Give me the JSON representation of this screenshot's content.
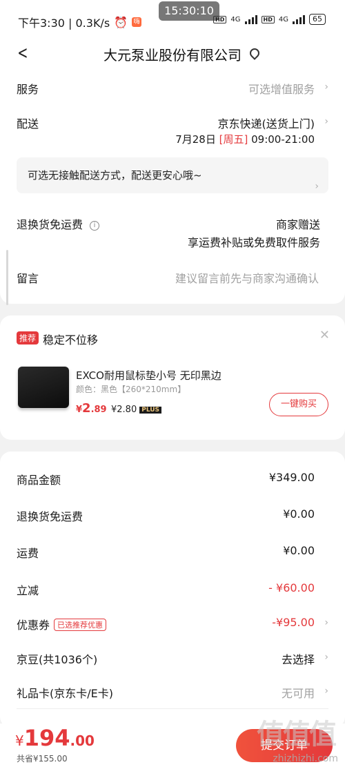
{
  "status_bar": {
    "left_text": "下午3:30 | 0.3K/s",
    "badge": "嗨",
    "time": "15:30:10",
    "net1": "HD",
    "sig1": "4G",
    "net2": "HD",
    "sig2": "4G",
    "battery": "65"
  },
  "nav": {
    "title": "大元泵业股份有限公司"
  },
  "order": {
    "service_label": "服务",
    "service_value": "可选增值服务",
    "delivery_label": "配送",
    "delivery_method": "京东快递(送货上门)",
    "delivery_date": "7月28日",
    "delivery_weekday": "[周五]",
    "delivery_time": "09:00-21:00",
    "contactless": "可选无接触配送方式，配送更安心哦~",
    "return_label": "退换货免运费",
    "return_value1": "商家赠送",
    "return_value2": "享运费补贴或免费取件服务",
    "note_label": "留言",
    "note_placeholder": "建议留言前先与商家沟通确认"
  },
  "recommend": {
    "tag": "推荐",
    "title": "稳定不位移",
    "product_name": "EXCO耐用鼠标垫小号 无印黑边",
    "product_spec": "颜色：黑色【260*210mm】",
    "price_symbol": "¥",
    "price_int": "2",
    "price_dec": ".89",
    "plus_price": "¥2.80",
    "plus_badge": "PLUS",
    "buy_label": "一键购买"
  },
  "summary": {
    "goods_label": "商品金额",
    "goods_value": "¥349.00",
    "return_fee_label": "退换货免运费",
    "return_fee_value": "¥0.00",
    "shipping_label": "运费",
    "shipping_value": "¥0.00",
    "discount_label": "立减",
    "discount_value": "- ¥60.00",
    "coupon_label": "优惠券",
    "coupon_tag": "已选推荐优惠",
    "coupon_value": "-¥95.00",
    "jingdou_label": "京豆(共1036个)",
    "jingdou_value": "去选择",
    "giftcard_label": "礼品卡(京东卡/E卡)",
    "giftcard_value": "无可用"
  },
  "bottom": {
    "currency": "¥",
    "total_int": "194",
    "total_dec": ".00",
    "saved": "共省¥155.00",
    "submit": "提交订单",
    "watermark": "zhizhizhi.com"
  },
  "colors": {
    "accent": "#e4393c",
    "background": "#f2f2f2"
  }
}
